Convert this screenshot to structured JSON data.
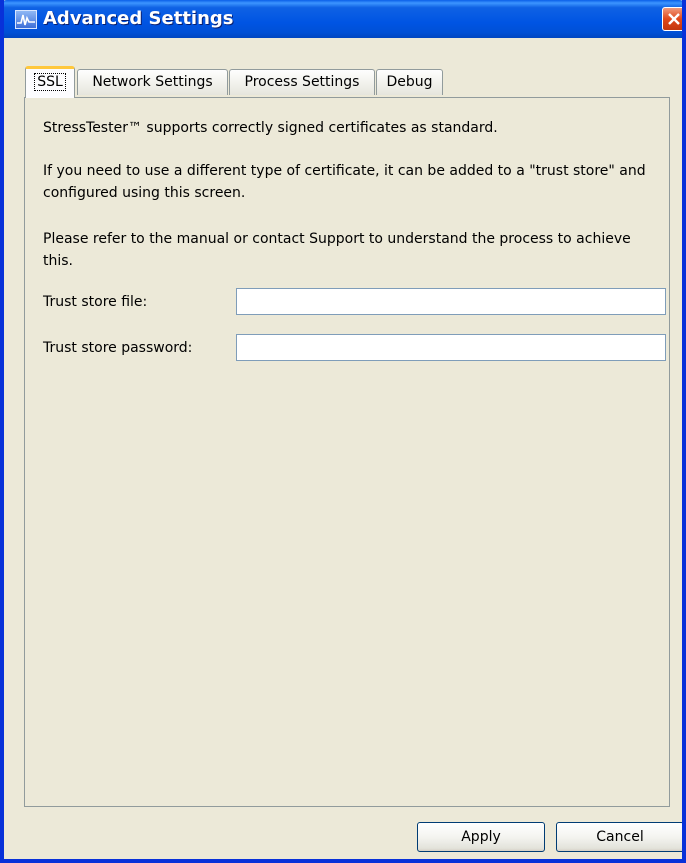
{
  "window": {
    "title": "Advanced Settings",
    "icon": "stresstester-app-icon",
    "close_icon": "close-icon"
  },
  "tabs": [
    {
      "label": "SSL",
      "active": true
    },
    {
      "label": "Network Settings",
      "active": false
    },
    {
      "label": "Process Settings",
      "active": false
    },
    {
      "label": "Debug",
      "active": false
    }
  ],
  "ssl": {
    "intro": "StressTester™ supports correctly signed certificates as standard.",
    "trust_store_info": "If you need to use a different type of certificate, it can be added to a \"trust store\" and configured using this screen.",
    "manual_info": "Please refer to the manual or contact Support to understand the process to achieve this.",
    "trust_store_file_label": "Trust store file:",
    "trust_store_file_value": "",
    "trust_store_password_label": "Trust store password:",
    "trust_store_password_value": ""
  },
  "buttons": {
    "apply": "Apply",
    "cancel": "Cancel"
  },
  "colors": {
    "titlebar": "#0054e3",
    "window_bg": "#ece9d8",
    "active_tab_highlight": "#ffc83c",
    "close_button": "#e0481b"
  }
}
